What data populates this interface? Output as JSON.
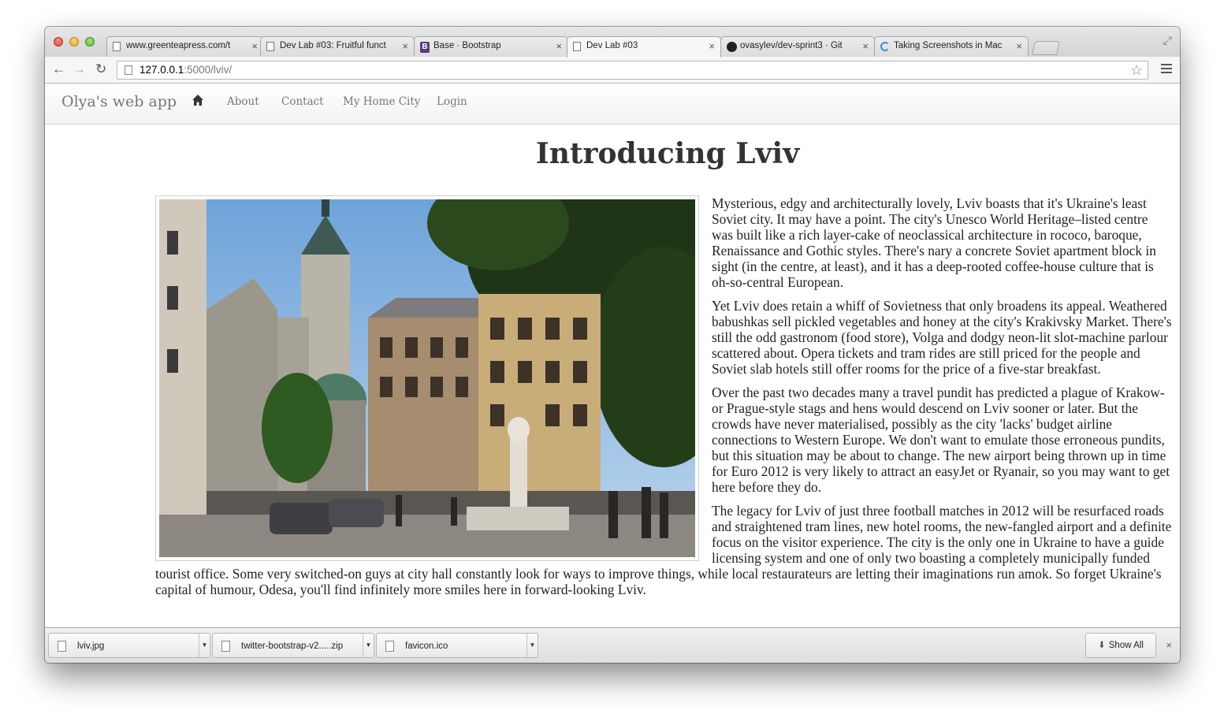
{
  "browser": {
    "tabs": [
      {
        "title": "www.greenteapress.com/t",
        "icon": "page-icon"
      },
      {
        "title": "Dev Lab #03: Fruitful funct",
        "icon": "page-icon"
      },
      {
        "title": "Base · Bootstrap",
        "icon": "bootstrap-icon"
      },
      {
        "title": "Dev Lab #03",
        "icon": "page-icon",
        "active": true
      },
      {
        "title": "ovasylev/dev-sprint3 · Git",
        "icon": "github-icon"
      },
      {
        "title": "Taking Screenshots in Mac",
        "icon": "loading-icon"
      }
    ],
    "close_glyph": "×",
    "url_host": "127.0.0.1",
    "url_rest": ":5000/lviv/"
  },
  "navbar": {
    "brand": "Olya's web app",
    "links": [
      "About",
      "Contact",
      "My Home City",
      "Login"
    ]
  },
  "page": {
    "title": "Introducing Lviv",
    "paragraphs": [
      "Mysterious, edgy and architecturally lovely, Lviv boasts that it's Ukraine's least Soviet city. It may have a point. The city's Unesco World Heritage–listed centre was built like a rich layer-cake of neoclassical architecture in rococo, baroque, Renaissance and Gothic styles. There's nary a concrete Soviet apartment block in sight (in the centre, at least), and it has a deep-rooted coffee-house culture that is oh-so-central European.",
      "Yet Lviv does retain a whiff of Sovietness that only broadens its appeal. Weathered babushkas sell pickled vegetables and honey at the city's Krakivsky Market. There's still the odd gastronom (food store), Volga and dodgy neon-lit slot-machine parlour scattered about. Opera tickets and tram rides are still priced for the people and Soviet slab hotels still offer rooms for the price of a five-star breakfast.",
      "Over the past two decades many a travel pundit has predicted a plague of Krakow- or Prague-style stags and hens would descend on Lviv sooner or later. But the crowds have never materialised, possibly as the city 'lacks' budget airline connections to Western Europe. We don't want to emulate those erroneous pundits, but this situation may be about to change. The new airport being thrown up in time for Euro 2012 is very likely to attract an easyJet or Ryanair, so you may want to get here before they do.",
      "The legacy for Lviv of just three football matches in 2012 will be resurfaced roads and straightened tram lines, new hotel rooms, the new-fangled airport and a definite focus on the visitor experience. The city is the only one in Ukraine to have a guide licensing system and one of only two boasting a completely municipally funded tourist office. Some very switched-on guys at city hall constantly look for ways to improve things, while local restaurateurs are letting their imaginations run amok. So forget Ukraine's capital of humour, Odesa, you'll find infinitely more smiles here in forward-looking Lviv."
    ]
  },
  "downloads": {
    "items": [
      "lviv.jpg",
      "twitter-bootstrap-v2.....zip",
      "favicon.ico"
    ],
    "show_all": "Show All",
    "close_glyph": "×"
  },
  "colors": {
    "navbar_text": "#777777",
    "body_text": "#222222",
    "title_text": "#333333"
  }
}
